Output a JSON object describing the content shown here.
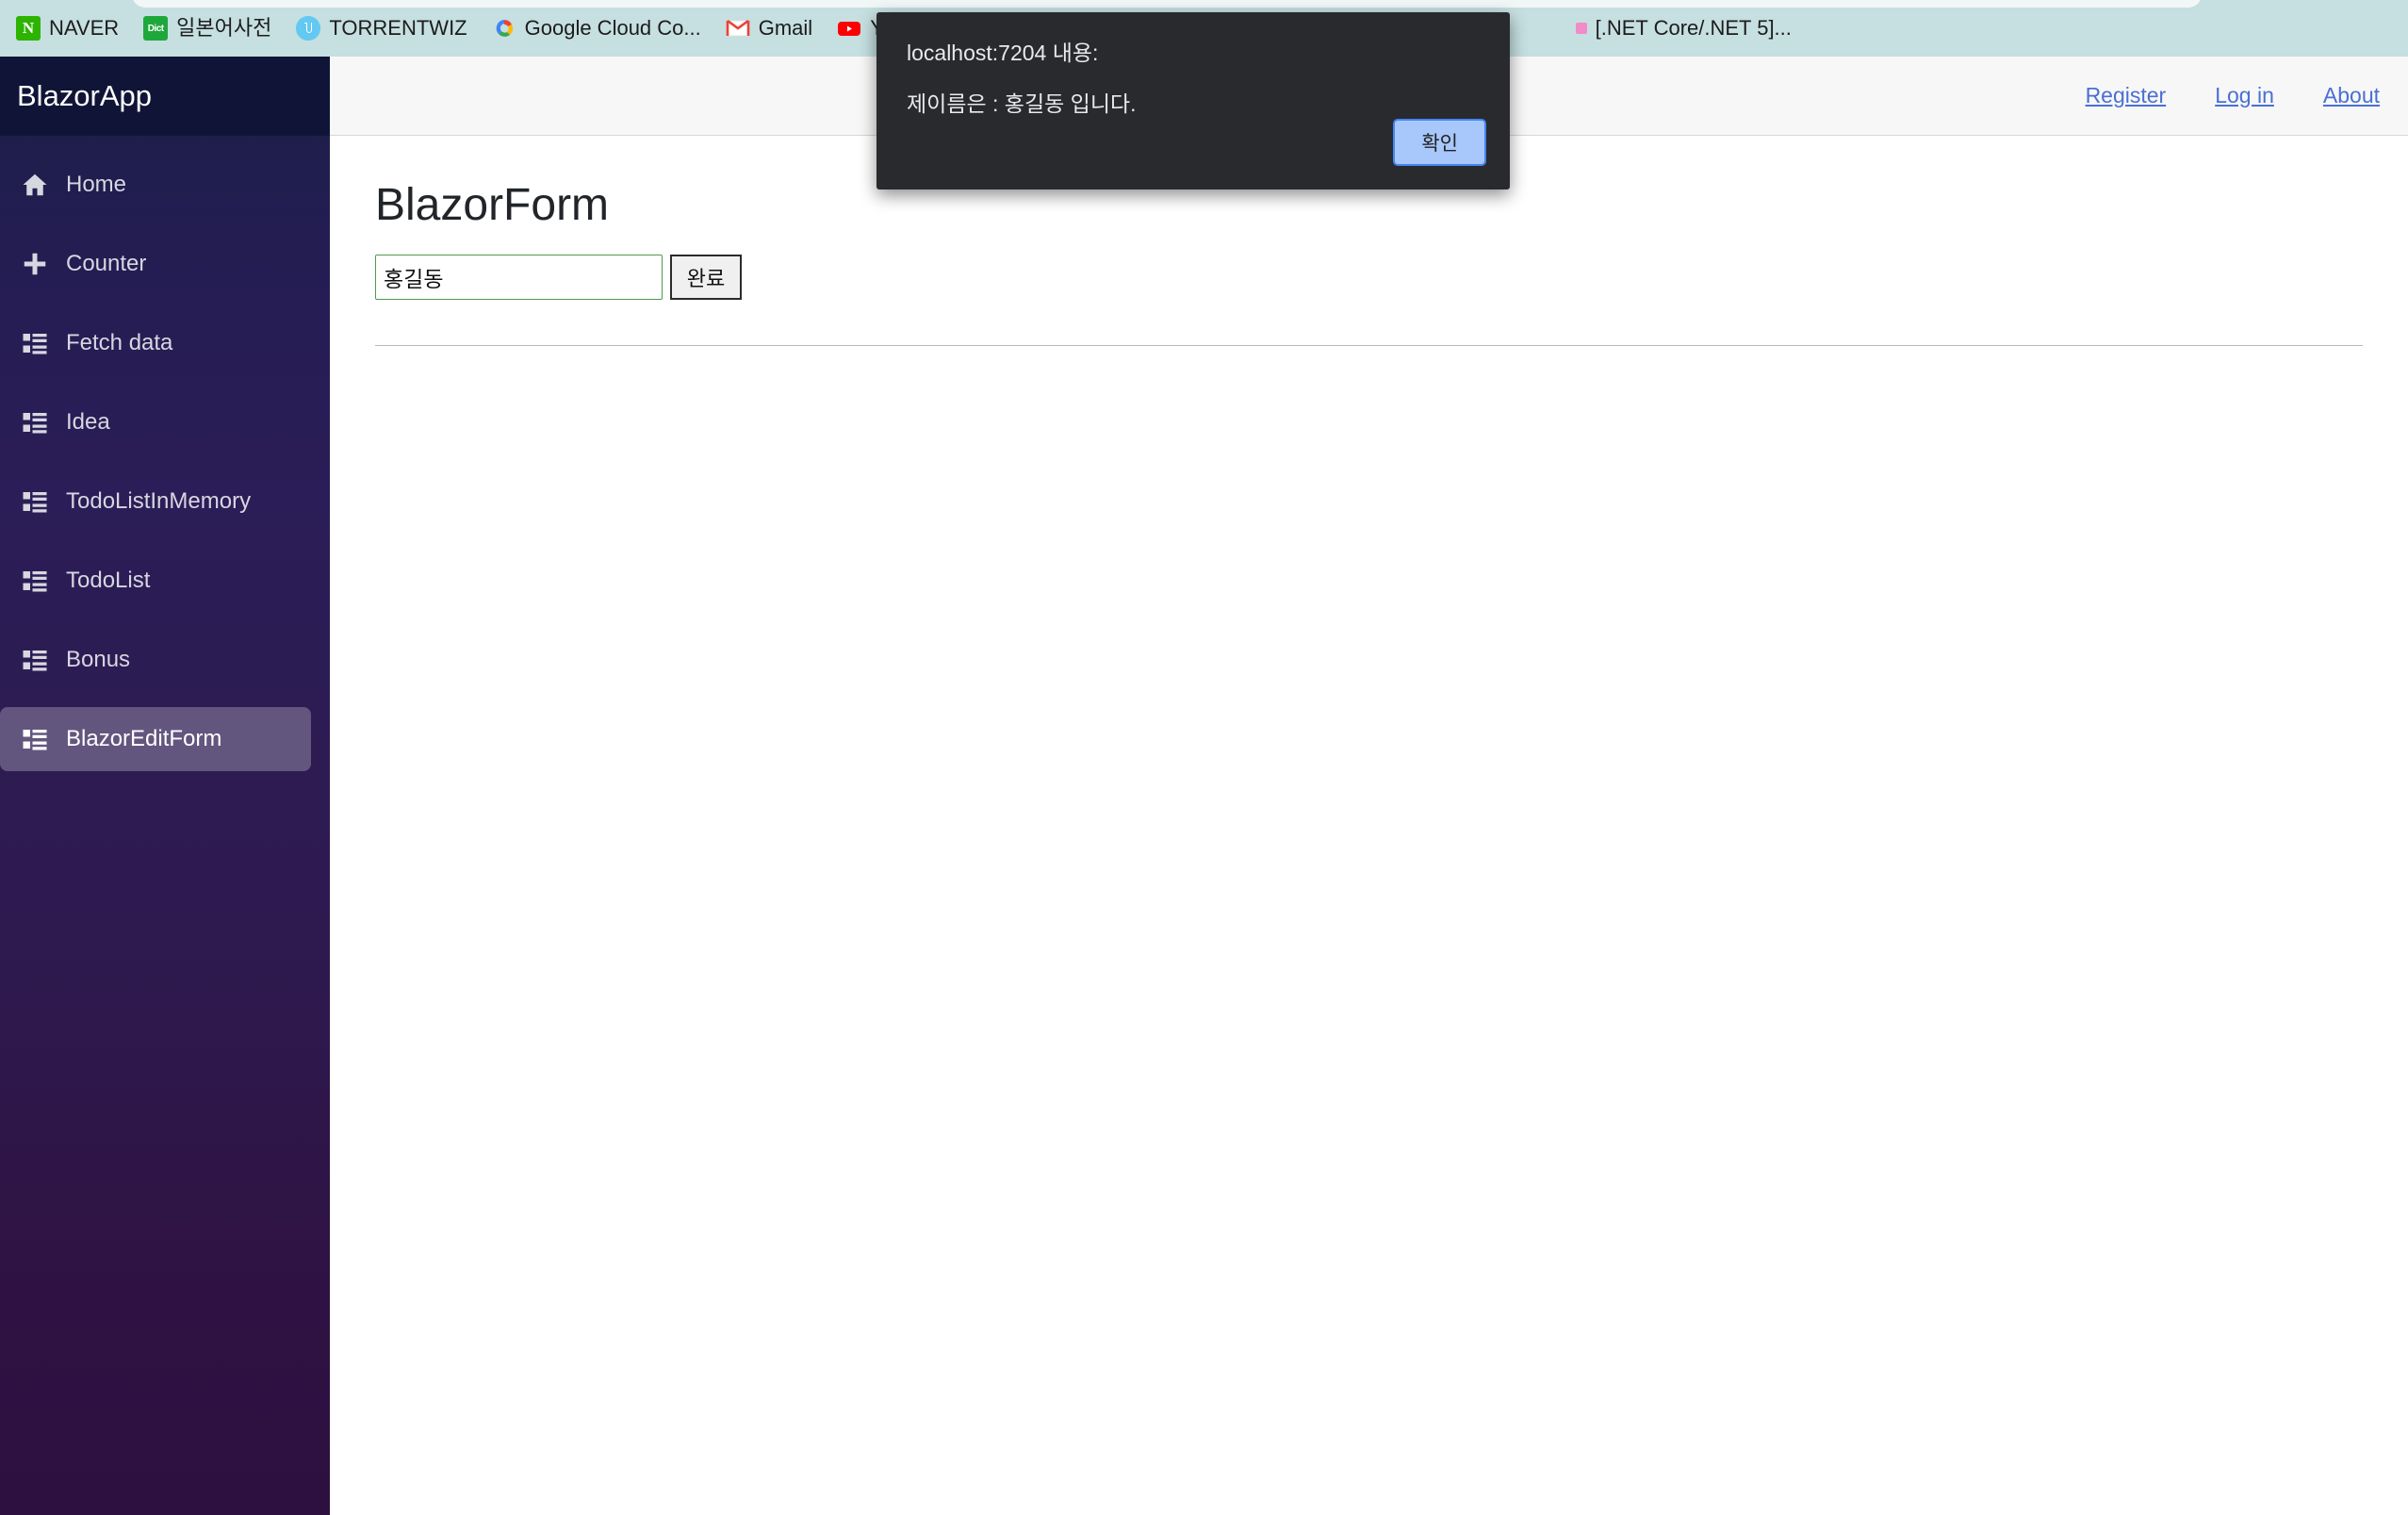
{
  "browser": {
    "bookmarks": [
      {
        "label": "NAVER",
        "icon": "naver-favicon"
      },
      {
        "label": "일본어사전",
        "icon": "japanese-dictionary-favicon"
      },
      {
        "label": "TORRENTWIZ",
        "icon": "torrentwiz-favicon"
      },
      {
        "label": "Google Cloud Co...",
        "icon": "google-cloud-favicon"
      },
      {
        "label": "Gmail",
        "icon": "gmail-favicon"
      },
      {
        "label": "YouTube",
        "icon": "youtube-favicon"
      },
      {
        "label": "",
        "icon": "google-maps-favicon"
      },
      {
        "label": "[.NET Core/.NET 5]...",
        "icon": "generic-favicon"
      }
    ],
    "bookmark_bar_color": "#C6DFE1"
  },
  "dialog": {
    "origin": "localhost:7204 내용:",
    "message": "제이름은 : 홍길동 입니다.",
    "ok_label": "확인",
    "background": "#292A2D",
    "ok_button_color": "#A8C7FA",
    "ok_button_border": "#4285F4"
  },
  "sidebar": {
    "brand": "BlazorApp",
    "items": [
      {
        "label": "Home",
        "icon": "home-icon",
        "active": false
      },
      {
        "label": "Counter",
        "icon": "plus-icon",
        "active": false
      },
      {
        "label": "Fetch data",
        "icon": "list-icon",
        "active": false
      },
      {
        "label": "Idea",
        "icon": "list-icon",
        "active": false
      },
      {
        "label": "TodoListInMemory",
        "icon": "list-icon",
        "active": false
      },
      {
        "label": "TodoList",
        "icon": "list-icon",
        "active": false
      },
      {
        "label": "Bonus",
        "icon": "list-icon",
        "active": false
      },
      {
        "label": "BlazorEditForm",
        "icon": "list-icon",
        "active": true
      }
    ]
  },
  "topbar": {
    "links": [
      {
        "label": "Register"
      },
      {
        "label": "Log in"
      },
      {
        "label": "About"
      }
    ],
    "link_color": "#4A6FD4"
  },
  "main": {
    "title": "BlazorForm",
    "input_value": "홍길동",
    "input_placeholder": "",
    "input_border_color": "#4e9a4e",
    "submit_label": "완료"
  }
}
